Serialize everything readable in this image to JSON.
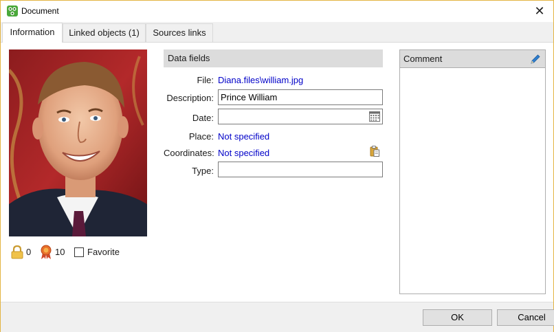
{
  "window": {
    "title": "Document",
    "close_glyph": "✕"
  },
  "tabs": [
    {
      "label": "Information",
      "active": true
    },
    {
      "label": "Linked objects (1)",
      "active": false
    },
    {
      "label": "Sources links",
      "active": false
    }
  ],
  "photo": {
    "subject": "portrait photo"
  },
  "stats": {
    "lock_count": "0",
    "award_count": "10",
    "favorite_label": "Favorite",
    "favorite_checked": false
  },
  "data_fields": {
    "header": "Data fields",
    "file_label": "File:",
    "file_value": "Diana.files\\william.jpg",
    "description_label": "Description:",
    "description_value": "Prince William",
    "date_label": "Date:",
    "date_value": "",
    "place_label": "Place:",
    "place_value": "Not specified",
    "coordinates_label": "Coordinates:",
    "coordinates_value": "Not specified",
    "type_label": "Type:",
    "type_value": ""
  },
  "comment": {
    "header": "Comment",
    "text": ""
  },
  "buttons": {
    "ok": "OK",
    "cancel": "Cancel"
  },
  "colors": {
    "link": "#0000c8",
    "window_border": "#e3b440",
    "header_bg": "#dcdcdc"
  },
  "icons": [
    "app-icon",
    "close-icon",
    "lock-icon",
    "award-icon",
    "calendar-icon",
    "paste-icon",
    "pencil-icon"
  ]
}
